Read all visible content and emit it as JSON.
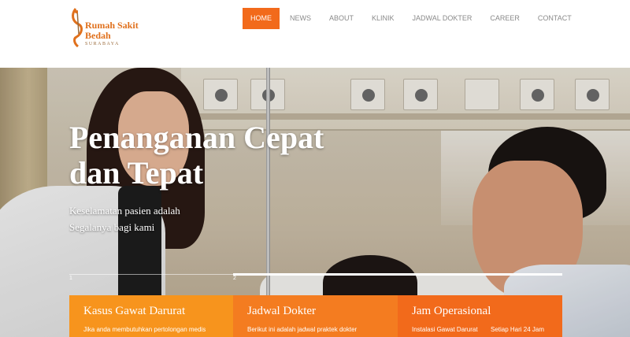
{
  "logo": {
    "line1": "Rumah Sakit",
    "line2": "Bedah",
    "line3": "SURABAYA"
  },
  "nav": {
    "items": [
      "HOME",
      "NEWS",
      "ABOUT",
      "KLINIK",
      "JADWAL DOKTER",
      "CAREER",
      "CONTACT"
    ],
    "active": "HOME"
  },
  "hero": {
    "title_line1": "Penanganan Cepat",
    "title_line2": "dan Tepat",
    "subtitle_line1": "Keselamatan pasien adalah",
    "subtitle_line2": "Segalanya bagi kami",
    "slide_numbers": [
      "1",
      "2"
    ],
    "active_slide": 2
  },
  "boxes": [
    {
      "title": "Kasus Gawat Darurat",
      "text": "Jika anda membutuhkan pertolongan medis"
    },
    {
      "title": "Jadwal Dokter",
      "text": "Berikut ini adalah jadwal praktek dokter"
    },
    {
      "title": "Jam Operasional",
      "label": "Instalasi Gawat Darurat",
      "value": "Setiap Hari 24 Jam"
    }
  ],
  "colors": {
    "accent": "#f26a1b",
    "box1": "#f7941d",
    "box2": "#f47c20",
    "box3": "#f26a1b"
  }
}
